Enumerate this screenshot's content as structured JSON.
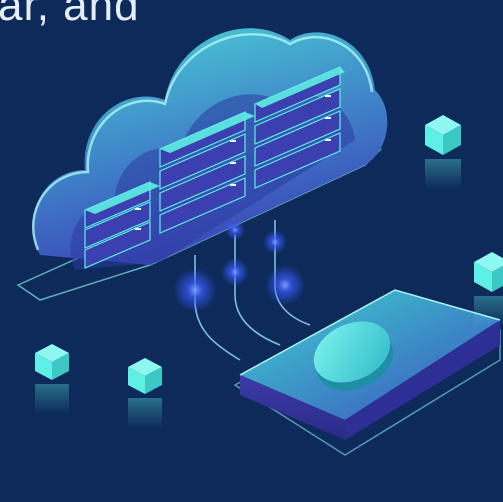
{
  "headline": {
    "text": "ar, and"
  },
  "colors": {
    "background": "#0d2a5a",
    "text": "#e6eef8",
    "cloud_top": "#4dd6d6",
    "cloud_bottom": "#3b45b8",
    "server_accent": "#5ef0e4",
    "glow": "#3a5cff",
    "cube": "#5ef0e4",
    "outline": "#7fe8e6"
  },
  "icons": {
    "cloud": "cloud-server-icon",
    "chip": "chip-platform-icon",
    "coin": "coin-icon",
    "cube": "cube-icon"
  }
}
